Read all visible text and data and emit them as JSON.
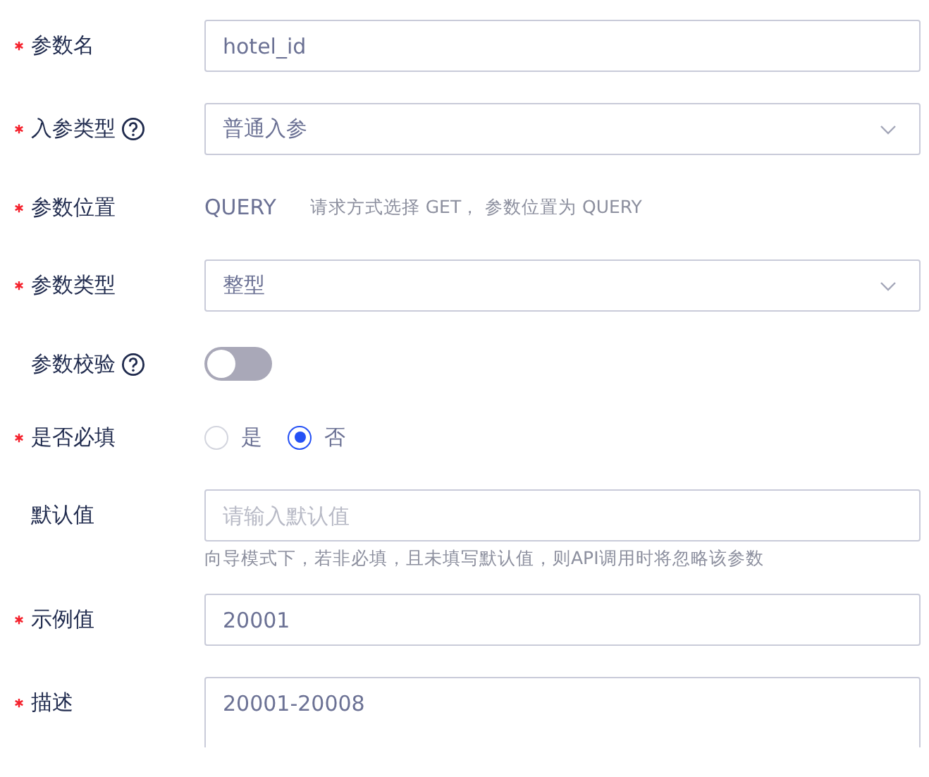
{
  "fields": [
    {
      "kind": "input",
      "label": "参数名",
      "required": true,
      "help": false,
      "value": "hotel_id"
    },
    {
      "kind": "select",
      "label": "入参类型",
      "required": true,
      "help": true,
      "value": "普通入参"
    },
    {
      "kind": "text",
      "label": "参数位置",
      "required": true,
      "help": false,
      "value": "QUERY",
      "note": "请求方式选择 GET， 参数位置为 QUERY"
    },
    {
      "kind": "select",
      "label": "参数类型",
      "required": true,
      "help": false,
      "value": "整型"
    },
    {
      "kind": "toggle",
      "label": "参数校验",
      "required": false,
      "help": true,
      "on": false
    },
    {
      "kind": "radio",
      "label": "是否必填",
      "required": true,
      "help": false,
      "options": [
        {
          "label": "是",
          "selected": false
        },
        {
          "label": "否",
          "selected": true
        }
      ]
    },
    {
      "kind": "input",
      "label": "默认值",
      "required": false,
      "help": false,
      "placeholder": "请输入默认值",
      "hint": "向导模式下，若非必填，且未填写默认值，则API调用时将忽略该参数"
    },
    {
      "kind": "input",
      "label": "示例值",
      "required": true,
      "help": false,
      "value": "20001"
    },
    {
      "kind": "textarea",
      "label": "描述",
      "required": true,
      "help": false,
      "value": "20001-20008"
    }
  ]
}
